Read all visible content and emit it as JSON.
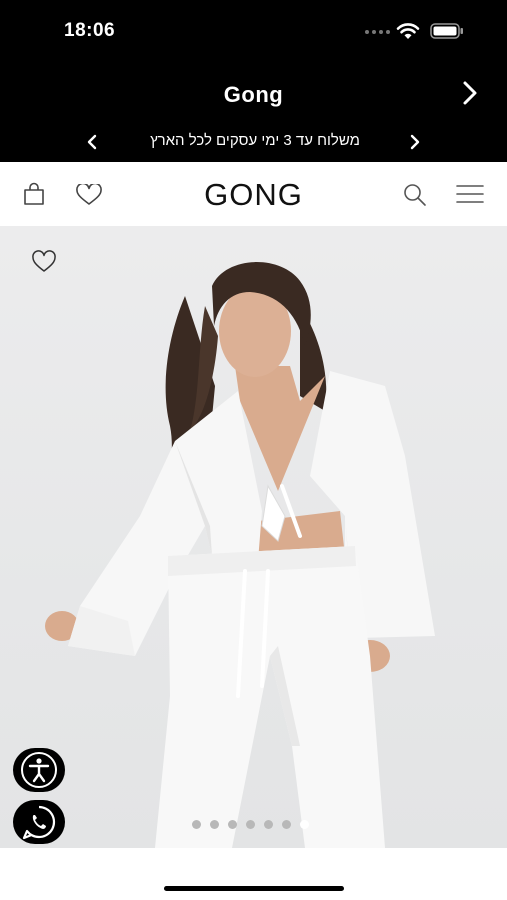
{
  "status_bar": {
    "time": "18:06",
    "icons": [
      "signal-dots-icon",
      "wifi-icon",
      "battery-icon"
    ]
  },
  "header": {
    "title": "Gong",
    "next_icon": "chevron-right-icon",
    "promo": {
      "text": "משלוח עד 3 ימי עסקים לכל הארץ",
      "prev_icon": "chevron-left-icon",
      "next_icon": "chevron-right-icon"
    }
  },
  "nav": {
    "logo": "GONG",
    "left_icons": [
      "shopping-bag-icon",
      "heart-icon"
    ],
    "right_icons": [
      "search-icon",
      "hamburger-menu-icon"
    ]
  },
  "product": {
    "favorite_icon": "heart-icon",
    "carousel": {
      "count": 7,
      "active_index": 6
    },
    "floating_buttons": [
      "accessibility-icon",
      "whatsapp-icon"
    ]
  },
  "colors": {
    "header_bg": "#000000",
    "header_text": "#ffffff",
    "nav_bg": "#ffffff",
    "image_bg": "#e8e8e9",
    "dot_inactive": "#b8b8b8",
    "dot_active": "#ffffff"
  }
}
